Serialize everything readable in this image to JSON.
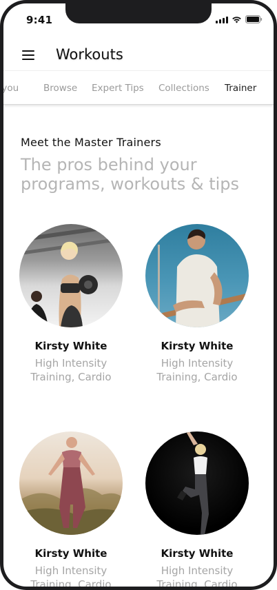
{
  "status_bar": {
    "time": "9:41"
  },
  "header": {
    "title": "Workouts"
  },
  "tabs": [
    {
      "label": "For you"
    },
    {
      "label": "Browse"
    },
    {
      "label": "Expert Tips"
    },
    {
      "label": "Collections"
    },
    {
      "label": "Trainer"
    }
  ],
  "active_tab": "Trainer",
  "section": {
    "label": "Meet the Master Trainers",
    "heading": "The pros behind your programs, workouts & tips"
  },
  "trainers": [
    {
      "name": "Kirsty White",
      "specialty": "High Intensity Training, Cardio"
    },
    {
      "name": "Kirsty White",
      "specialty": "High Intensity Training, Cardio"
    },
    {
      "name": "Kirsty White",
      "specialty": "High Intensity Training, Cardio"
    },
    {
      "name": "Kirsty White",
      "specialty": "High Intensity Training, Cardio"
    }
  ],
  "colors": {
    "text_primary": "#111111",
    "text_secondary": "#a5a5a5",
    "tab_inactive": "#9a9a9a"
  }
}
